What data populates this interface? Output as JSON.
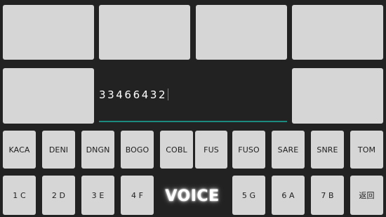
{
  "input": {
    "value": "33466432"
  },
  "keys": {
    "row1": [
      "KACA",
      "DENI",
      "DNGN",
      "BOGO",
      "COBL",
      "FUS",
      "FUSO",
      "SARE",
      "SNRE",
      "TOM"
    ],
    "row2_left": [
      "1 C",
      "2 D",
      "3 E",
      "4 F"
    ],
    "voice_label": "VOICE",
    "row2_right": [
      "5 G",
      "6 A",
      "7 B",
      "返回"
    ]
  },
  "colors": {
    "background": "#222222",
    "tile": "#d6d6d6",
    "accent": "#1d8a80"
  }
}
